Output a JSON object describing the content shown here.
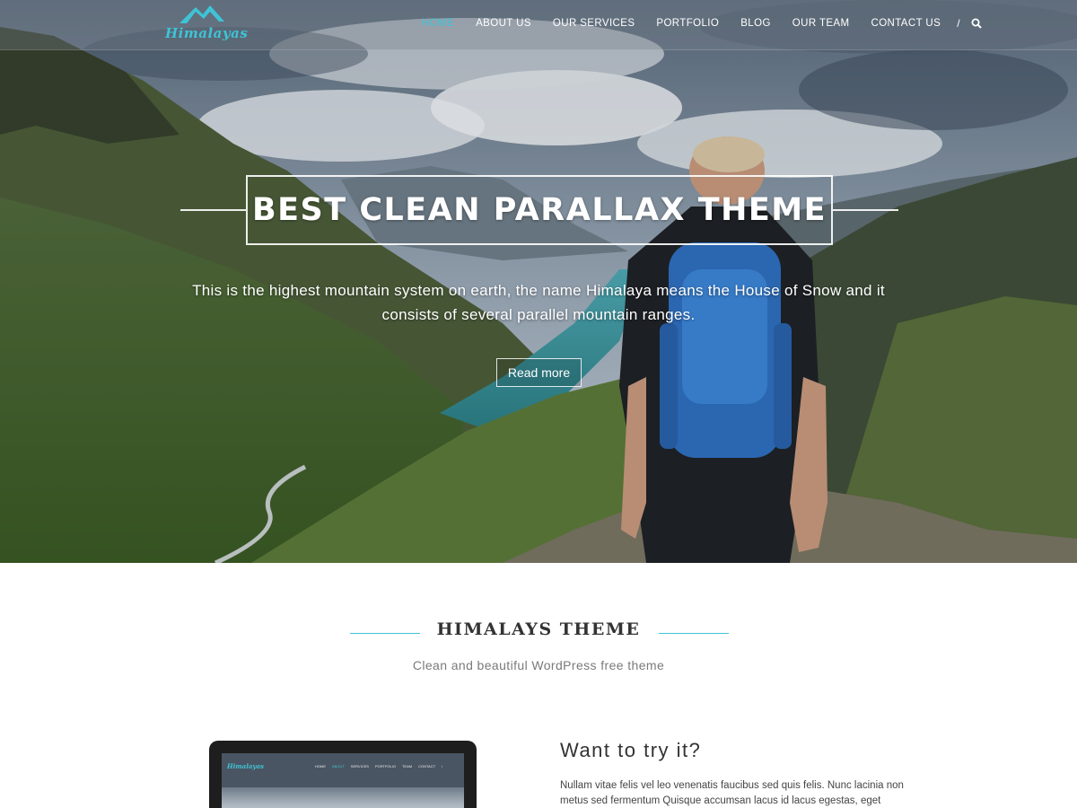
{
  "brand": {
    "logo_text": "Himalayas"
  },
  "nav": {
    "items": [
      {
        "label": "HOME",
        "active": true
      },
      {
        "label": "ABOUT US",
        "active": false
      },
      {
        "label": "OUR SERVICES",
        "active": false
      },
      {
        "label": "PORTFOLIO",
        "active": false
      },
      {
        "label": "BLOG",
        "active": false
      },
      {
        "label": "OUR TEAM",
        "active": false
      },
      {
        "label": "CONTACT US",
        "active": false
      }
    ],
    "separator": "/",
    "search_icon": "search-icon"
  },
  "hero": {
    "title": "BEST CLEAN PARALLAX THEME",
    "subtitle": "This is the highest mountain system on earth, the name Himalaya means the House of Snow and it consists of several parallel mountain ranges.",
    "button_label": "Read more"
  },
  "section": {
    "title": "HIMALAYS THEME",
    "subtitle": "Clean and beautiful WordPress free theme"
  },
  "preview": {
    "logo_text": "Himalayas",
    "nav": [
      "HOME",
      "ABOUT",
      "SERVICES",
      "PORTFOLIO",
      "TEAM",
      "CONTACT",
      "/"
    ]
  },
  "try": {
    "title": "Want to try it?",
    "text": "Nullam vitae felis vel leo venenatis faucibus sed quis felis. Nunc lacinia non metus sed fermentum Quisque accumsan lacus id lacus egestas, eget commodo augue"
  },
  "colors": {
    "accent": "#3fc3d6",
    "heading": "#333333",
    "muted": "#7a7a7a"
  }
}
